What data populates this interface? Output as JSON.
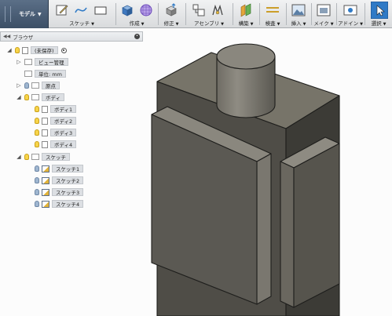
{
  "toolbar": {
    "workspace": "モデル",
    "groups": [
      {
        "label": "スケッチ",
        "icons": [
          "sketch-pencil-icon",
          "spline-icon",
          "rectangle-icon"
        ]
      },
      {
        "label": "作成",
        "icons": [
          "box-create-icon",
          "grid-sphere-icon"
        ]
      },
      {
        "label": "修正",
        "icons": [
          "press-pull-icon"
        ]
      },
      {
        "label": "アセンブリ",
        "icons": [
          "new-component-icon",
          "joint-icon"
        ]
      },
      {
        "label": "構築",
        "icons": [
          "offset-plane-icon"
        ]
      },
      {
        "label": "検査",
        "icons": [
          "measure-icon"
        ]
      },
      {
        "label": "挿入",
        "icons": [
          "insert-image-icon"
        ]
      },
      {
        "label": "メイク",
        "icons": [
          "make-print-icon"
        ]
      },
      {
        "label": "アドイン",
        "icons": [
          "addin-gear-icon"
        ]
      },
      {
        "label": "選択",
        "icons": [
          "select-cursor-icon"
        ]
      }
    ]
  },
  "browser": {
    "title": "ブラウザ",
    "root": "(未保存)",
    "named_views": "ビュー管理",
    "units": "単位: mm",
    "origin": "原点",
    "bodies_folder": "ボディ",
    "bodies": [
      "ボディ1",
      "ボディ2",
      "ボディ3",
      "ボディ4"
    ],
    "sketches_folder": "スケッチ",
    "sketches": [
      "スケッチ1",
      "スケッチ2",
      "スケッチ3",
      "スケッチ4"
    ]
  },
  "colors": {
    "toolbar_bg": "#e4e6e8",
    "workspace_bg": "#4a5d75",
    "body_dark": "#55534d",
    "body_mid": "#7b786f",
    "body_light": "#8e8b82",
    "edge": "#1e1e1c",
    "selected_bg": "#dcdfe3",
    "accent_blue": "#2f7ac6"
  }
}
